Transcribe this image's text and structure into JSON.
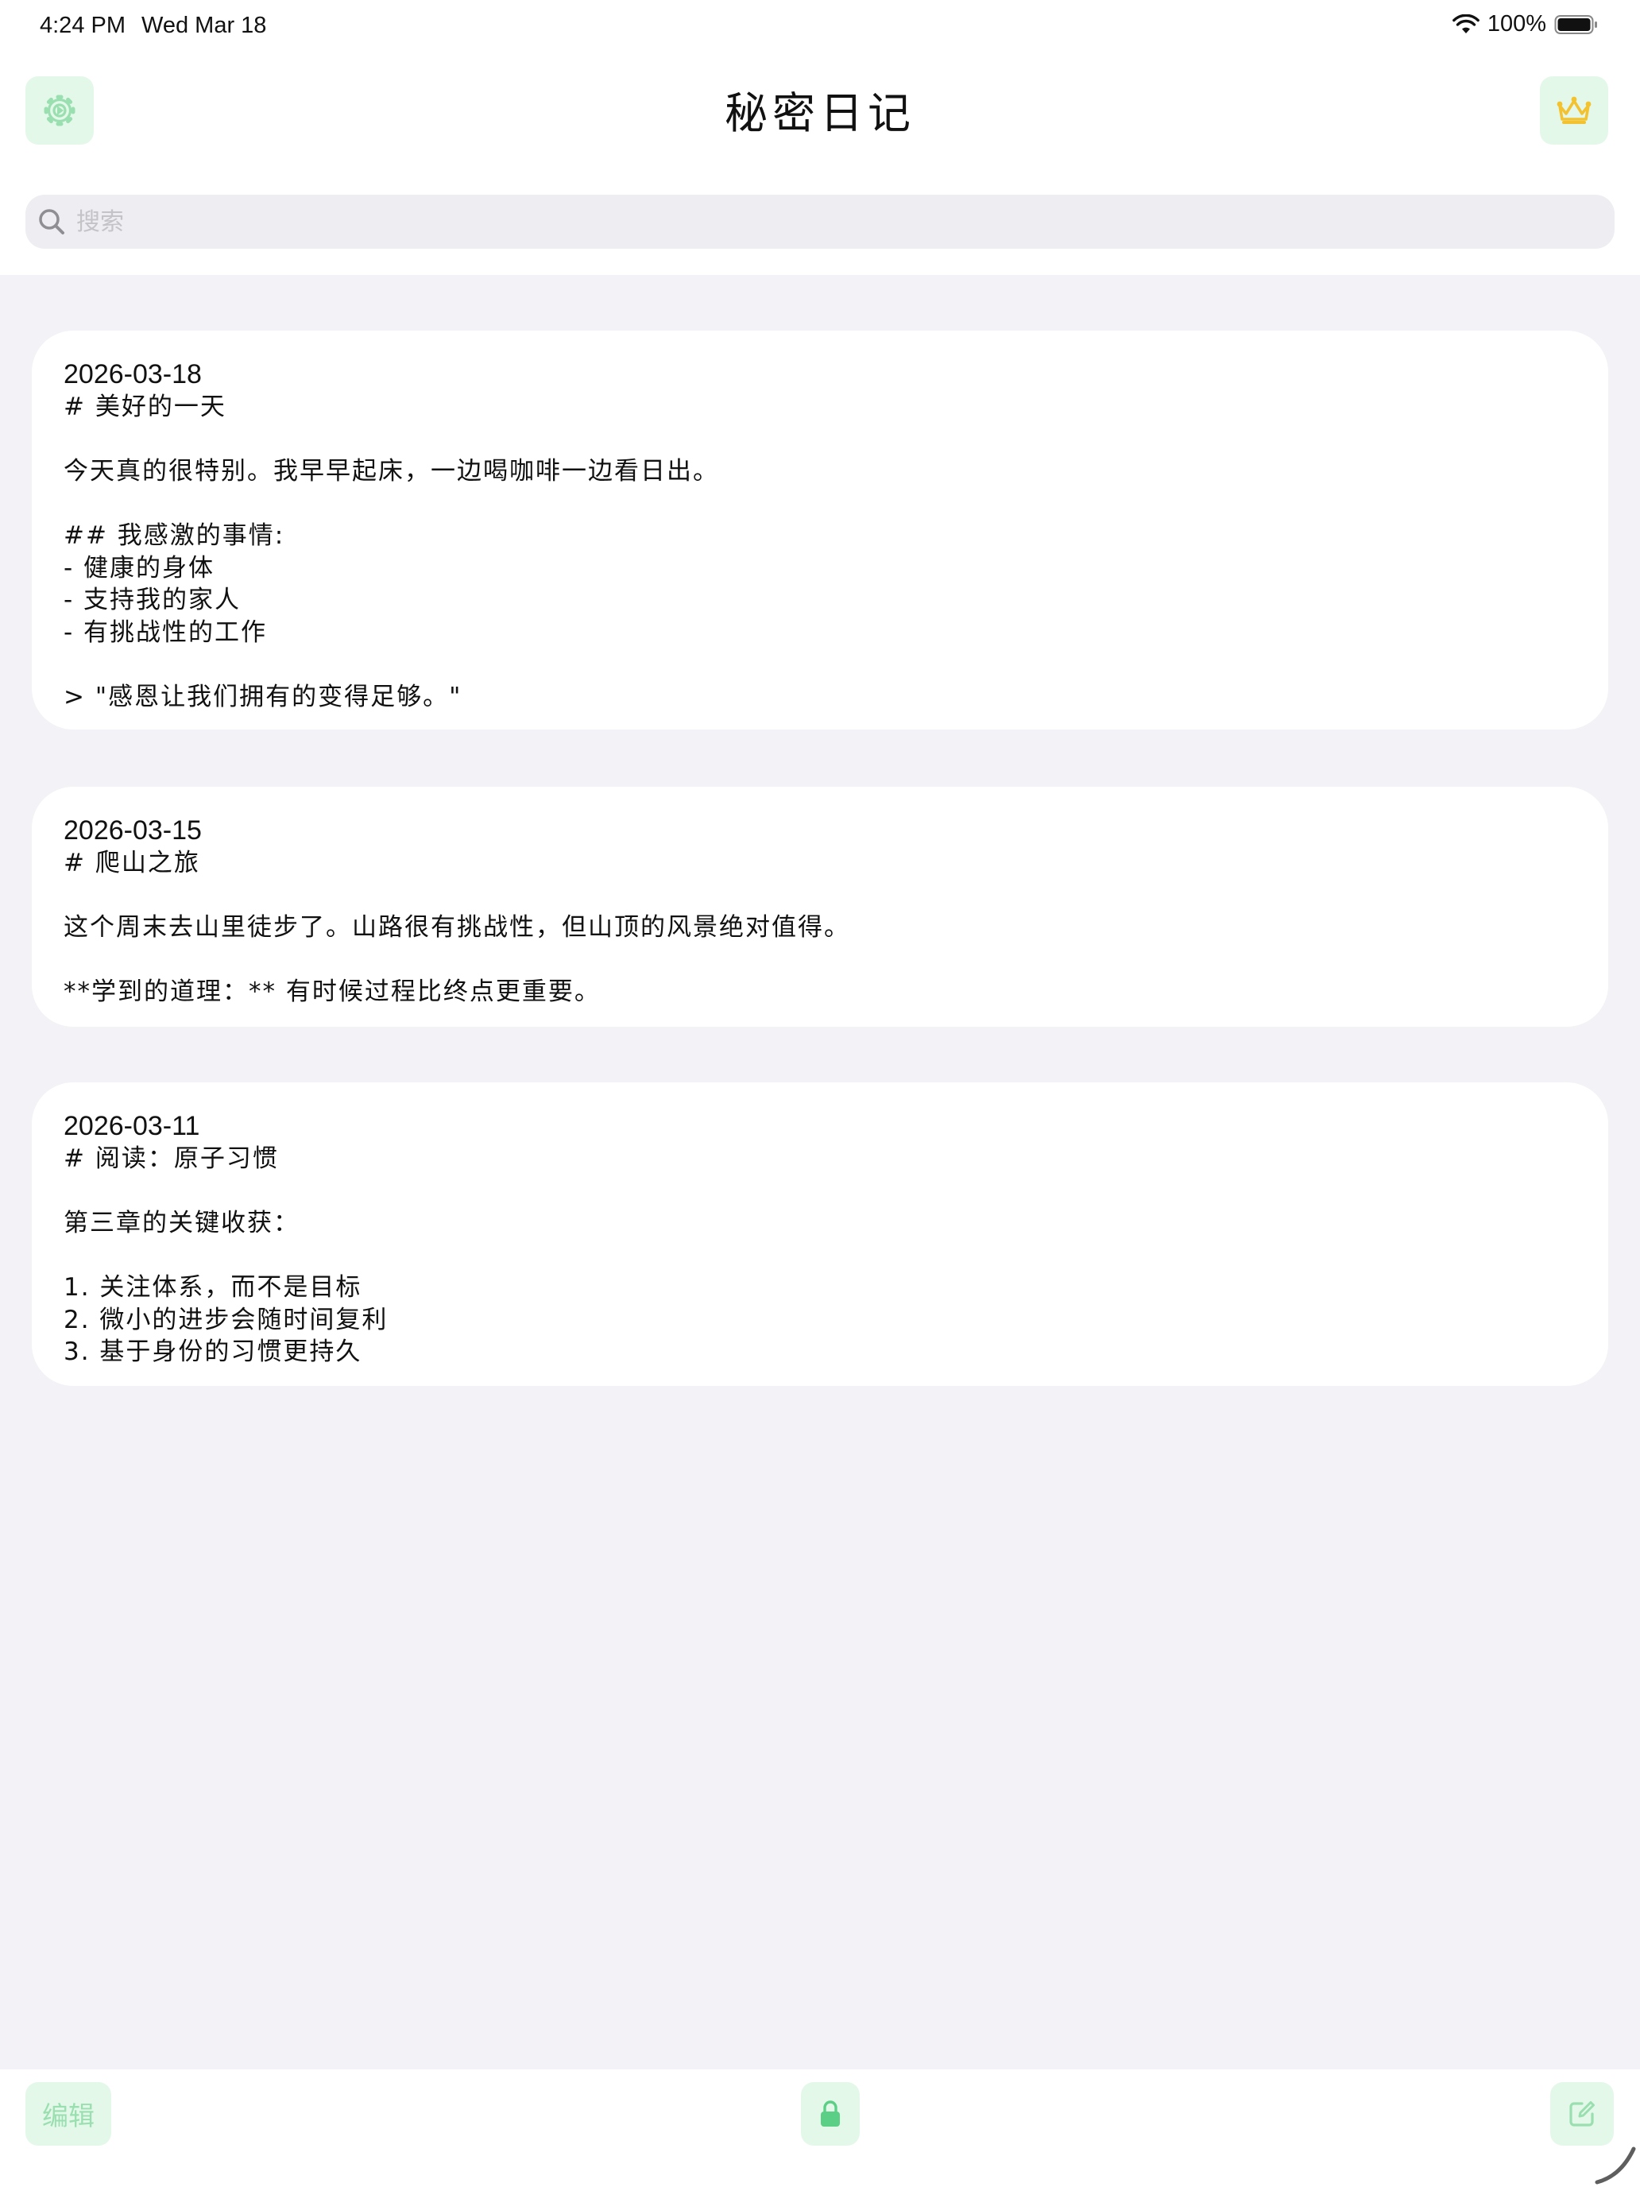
{
  "status_bar": {
    "time": "4:24 PM",
    "date": "Wed Mar 18",
    "battery": "100%",
    "icons": [
      "wifi-icon",
      "battery-icon"
    ]
  },
  "header": {
    "title": "秘密日记",
    "settings_icon": "gear-icon",
    "premium_icon": "crown-icon"
  },
  "search": {
    "placeholder": "搜索",
    "value": ""
  },
  "entries": [
    {
      "date": "2026-03-18",
      "lines": [
        "# 美好的一天",
        "",
        "今天真的很特别。我早早起床，一边喝咖啡一边看日出。",
        "",
        "## 我感激的事情:",
        "- 健康的身体",
        "- 支持我的家人",
        "- 有挑战性的工作",
        "",
        "> \"感恩让我们拥有的变得足够。\""
      ]
    },
    {
      "date": "2026-03-15",
      "lines": [
        "# 爬山之旅",
        "",
        "这个周末去山里徒步了。山路很有挑战性，但山顶的风景绝对值得。",
        "",
        "**学到的道理：** 有时候过程比终点更重要。"
      ]
    },
    {
      "date": "2026-03-11",
      "lines": [
        "# 阅读：原子习惯",
        "",
        "第三章的关键收获：",
        "",
        "1. 关注体系，而不是目标",
        "2. 微小的进步会随时间复利",
        "3. 基于身份的习惯更持久"
      ]
    }
  ],
  "toolbar": {
    "edit_label": "编辑",
    "lock_icon": "lock-icon",
    "compose_icon": "compose-icon"
  },
  "colors": {
    "accent_bg": "#e4f8ea",
    "accent": "#5ccf86",
    "crown": "#f2c230",
    "background": "#f2f2f7"
  }
}
